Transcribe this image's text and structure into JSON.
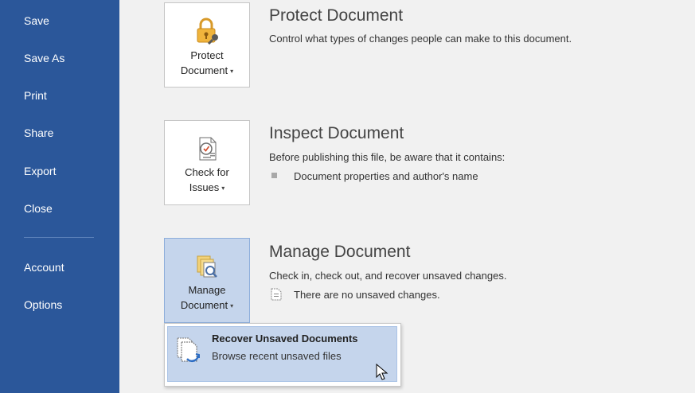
{
  "sidebar": {
    "items": [
      {
        "label": "Save"
      },
      {
        "label": "Save As"
      },
      {
        "label": "Print"
      },
      {
        "label": "Share"
      },
      {
        "label": "Export"
      },
      {
        "label": "Close"
      },
      {
        "label": "Account"
      },
      {
        "label": "Options"
      }
    ]
  },
  "protect": {
    "button_line1": "Protect",
    "button_line2": "Document",
    "caret": "▾",
    "title": "Protect Document",
    "description": "Control what types of changes people can make to this document.",
    "icon": "lock-key-icon"
  },
  "inspect": {
    "button_line1": "Check for",
    "button_line2": "Issues",
    "caret": "▾",
    "title": "Inspect Document",
    "description": "Before publishing this file, be aware that it contains:",
    "bullets": [
      "Document properties and author's name"
    ],
    "icon": "inspect-document-icon"
  },
  "manage": {
    "button_line1": "Manage",
    "button_line2": "Document",
    "caret": "▾",
    "title": "Manage Document",
    "description": "Check in, check out, and recover unsaved changes.",
    "status": "There are no unsaved changes.",
    "icon": "manage-document-icon"
  },
  "dropdown": {
    "title": "Recover Unsaved Documents",
    "description": "Browse recent unsaved files",
    "icon": "recover-documents-icon"
  },
  "colors": {
    "sidebar": "#2b579a",
    "active_button": "#c5d5ec",
    "background": "#f1f1f1"
  }
}
